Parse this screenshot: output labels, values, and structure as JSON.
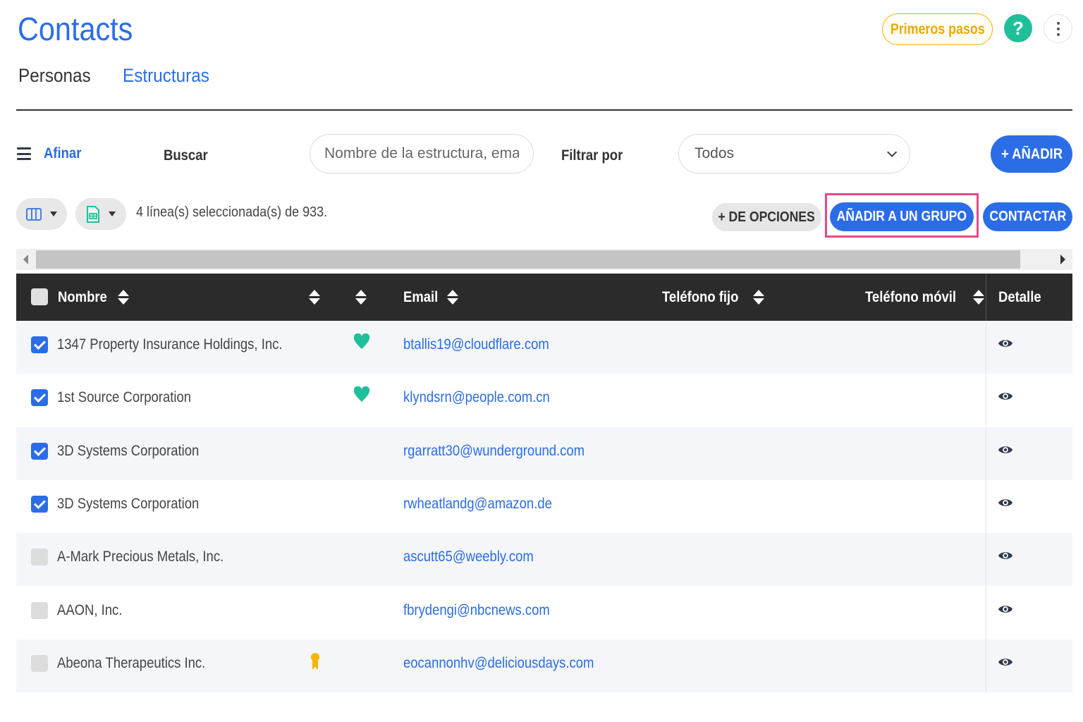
{
  "app": {
    "title": "Contacts"
  },
  "header": {
    "getting_started": "Primeros pasos",
    "help": "?"
  },
  "tabs": [
    {
      "label": "Personas",
      "active": false
    },
    {
      "label": "Estructuras",
      "active": true
    }
  ],
  "toolbar": {
    "refine_label": "Afinar",
    "search_label": "Buscar",
    "search_placeholder": "Nombre de la estructura, email, ...",
    "filter_label": "Filtrar por",
    "filter_value": "Todos",
    "add_button": "+ AÑADIR"
  },
  "selection": {
    "count_text": "4 línea(s) seleccionada(s) de 933.",
    "more_options": "+ DE OPCIONES",
    "add_to_group": "AÑADIR A UN GRUPO",
    "contact": "CONTACTAR"
  },
  "table": {
    "headers": {
      "name": "Nombre",
      "email": "Email",
      "phone_landline": "Teléfono fijo",
      "phone_mobile": "Teléfono móvil",
      "detail": "Detalle"
    },
    "rows": [
      {
        "checked": true,
        "name": "1347 Property Insurance Holdings, Inc.",
        "email": "btallis19@cloudflare.com",
        "icon": "heart-icon"
      },
      {
        "checked": true,
        "name": "1st Source Corporation",
        "email": "klyndsrn@people.com.cn",
        "icon": "heart-icon"
      },
      {
        "checked": true,
        "name": "3D Systems Corporation",
        "email": "rgarratt30@wunderground.com",
        "icon": ""
      },
      {
        "checked": true,
        "name": "3D Systems Corporation",
        "email": "rwheatlandg@amazon.de",
        "icon": ""
      },
      {
        "checked": false,
        "name": "A-Mark Precious Metals, Inc.",
        "email": "ascutt65@weebly.com",
        "icon": ""
      },
      {
        "checked": false,
        "name": "AAON, Inc.",
        "email": "fbrydengi@nbcnews.com",
        "icon": ""
      },
      {
        "checked": false,
        "name": "Abeona Therapeutics Inc.",
        "email": "eocannonhv@deliciousdays.com",
        "icon": "medal-icon"
      }
    ]
  },
  "colors": {
    "accent": "#2b6de6",
    "getting_started": "#f0a800",
    "help": "#1fbf9a",
    "heart": "#1fbf9a",
    "highlight": "#e8488a",
    "header_bg": "#2b2b2b"
  }
}
